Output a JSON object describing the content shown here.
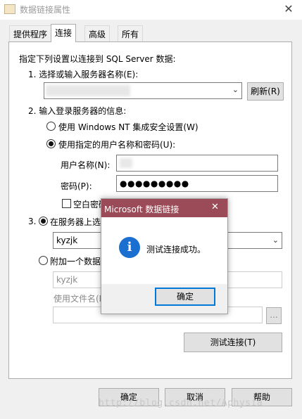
{
  "window": {
    "title": "数据链接属性",
    "close_glyph": "✕"
  },
  "tabs": [
    {
      "label": "提供程序"
    },
    {
      "label": "连接"
    },
    {
      "label": "高级"
    },
    {
      "label": "所有"
    }
  ],
  "connection": {
    "intro": "指定下列设置以连接到 SQL Server 数据:",
    "step1_label": "1. 选择或输入服务器名称(E):",
    "server_value": "",
    "refresh_button": "刷新(R)",
    "step2_label": "2. 输入登录服务器的信息:",
    "radio_windows_nt": "使用 Windows NT 集成安全设置(W)",
    "radio_specific_user": "使用指定的用户名称和密码(U):",
    "username_label": "用户名称(N):",
    "username_value": "",
    "password_label": "密码(P):",
    "password_value": "●●●●●●●●●",
    "blank_password_label": "空白密码",
    "step3_label": "3.",
    "radio_select_db": "在服务器上选",
    "database_value": "kyzjk",
    "radio_attach_db": "附加一个数据",
    "attach_db_value": "kyzjk",
    "filename_label": "使用文件名(F",
    "browse_button": "...",
    "test_connection_button": "测试连接(T)"
  },
  "footer": {
    "ok_button": "确定",
    "cancel_button": "取消",
    "help_button": "帮助"
  },
  "message_box": {
    "title": "Microsoft 数据链接",
    "close_glyph": "✕",
    "info_glyph": "i",
    "message": "测试连接成功。",
    "ok_button": "确定"
  },
  "watermark": "http://blog.csdn.net/Aphysia",
  "colors": {
    "message_title_bar": "#9b4b57",
    "info_icon": "#1a6fd0",
    "focus_border": "#0078d7"
  }
}
